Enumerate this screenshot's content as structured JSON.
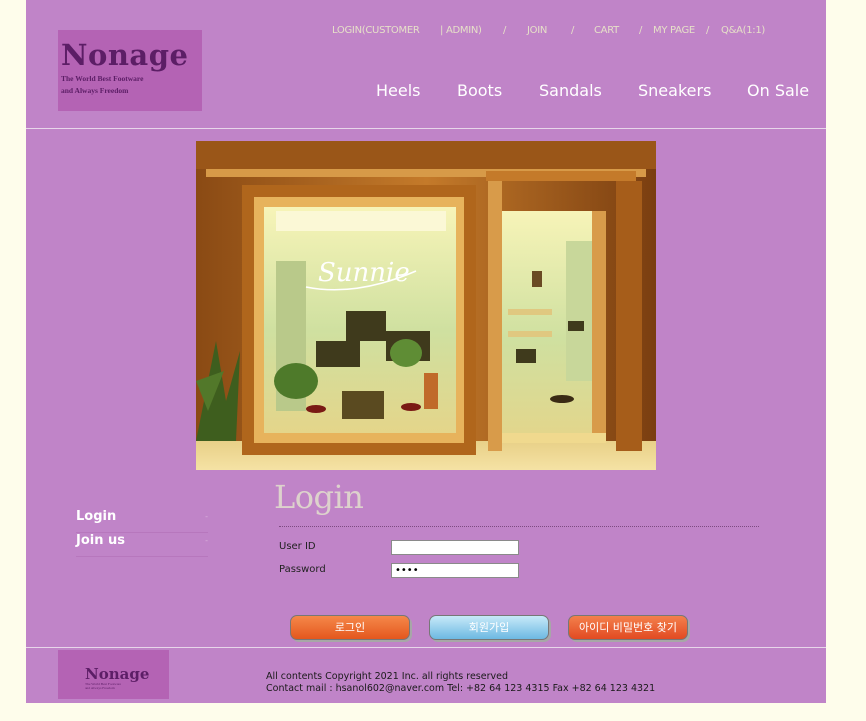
{
  "logo": {
    "brand": "Nonage",
    "tagline_line1": "The World Best Footware",
    "tagline_line2": "and Always Freedom"
  },
  "topmenu": {
    "login_customer": "LOGIN(CUSTOMER",
    "admin": "| ADMIN)",
    "join": "JOIN",
    "cart": "CART",
    "mypage": "MY PAGE",
    "qna": "Q&A(1:1)",
    "sep": "/"
  },
  "nav": [
    "Heels",
    "Boots",
    "Sandals",
    "Sneakers",
    "On Sale"
  ],
  "hero": {
    "sign": "Sunnie"
  },
  "sidebar": {
    "items": [
      {
        "label": "Login"
      },
      {
        "label": "Join us"
      }
    ],
    "marker": "-"
  },
  "login": {
    "title": "Login",
    "userid_label": "User ID",
    "password_label": "Password",
    "userid_value": "",
    "password_value": "••••"
  },
  "buttons": {
    "login": "로그인",
    "join": "회원가입",
    "find": "아이디 비밀번호 찾기"
  },
  "footer": {
    "brand": "Nonage",
    "tagline_line1": "The World Best Footware",
    "tagline_line2": "and Always Freedom",
    "copyright": "All contents Copyright 2021 Inc. all rights reserved",
    "contact": "Contact mail : hsanol602@naver.com Tel: +82 64 123 4315 Fax +82 64 123 4321"
  }
}
